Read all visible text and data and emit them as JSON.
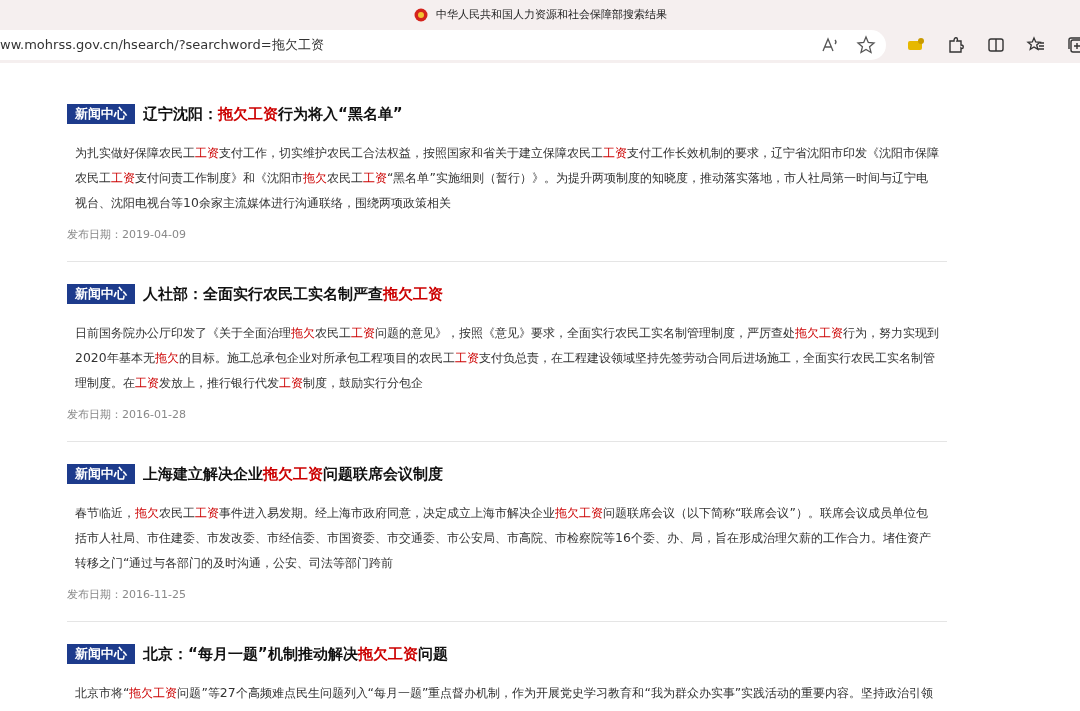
{
  "window": {
    "title": "中华人民共和国人力资源和社会保障部搜索结果"
  },
  "address_bar": {
    "url": "ww.mohrss.gov.cn/hsearch/?searchword=拖欠工资"
  },
  "results": [
    {
      "badge": "新闻中心",
      "title": [
        {
          "text": "辽宁沈阳：",
          "hit": false
        },
        {
          "text": "拖欠工资",
          "hit": true
        },
        {
          "text": "行为将入“黑名单”",
          "hit": false
        }
      ],
      "summary": [
        {
          "text": "为扎实做好保障农民工",
          "hit": false
        },
        {
          "text": "工资",
          "hit": true
        },
        {
          "text": "支付工作，切实维护农民工合法权益，按照国家和省关于建立保障农民工",
          "hit": false
        },
        {
          "text": "工资",
          "hit": true
        },
        {
          "text": "支付工作长效机制的要求，辽宁省沈阳市印发《沈阳市保障农民工",
          "hit": false
        },
        {
          "text": "工资",
          "hit": true
        },
        {
          "text": "支付问责工作制度》和《沈阳市",
          "hit": false
        },
        {
          "text": "拖欠",
          "hit": true
        },
        {
          "text": "农民工",
          "hit": false
        },
        {
          "text": "工资",
          "hit": true
        },
        {
          "text": "“黑名单”实施细则（暂行）》。为提升两项制度的知晓度，推动落实落地，市人社局第一时间与辽宁电视台、沈阳电视台等10余家主流媒体进行沟通联络，围绕两项政策相关",
          "hit": false
        }
      ],
      "date": "发布日期：2019-04-09"
    },
    {
      "badge": "新闻中心",
      "title": [
        {
          "text": "人社部：全面实行农民工实名制严查",
          "hit": false
        },
        {
          "text": "拖欠工资",
          "hit": true
        }
      ],
      "summary": [
        {
          "text": "日前国务院办公厅印发了《关于全面治理",
          "hit": false
        },
        {
          "text": "拖欠",
          "hit": true
        },
        {
          "text": "农民工",
          "hit": false
        },
        {
          "text": "工资",
          "hit": true
        },
        {
          "text": "问题的意见》，按照《意见》要求，全面实行农民工实名制管理制度，严厉查处",
          "hit": false
        },
        {
          "text": "拖欠工资",
          "hit": true
        },
        {
          "text": "行为，努力实现到2020年基本无",
          "hit": false
        },
        {
          "text": "拖欠",
          "hit": true
        },
        {
          "text": "的目标。施工总承包企业对所承包工程项目的农民工",
          "hit": false
        },
        {
          "text": "工资",
          "hit": true
        },
        {
          "text": "支付负总责，在工程建设领域坚持先签劳动合同后进场施工，全面实行农民工实名制管理制度。在",
          "hit": false
        },
        {
          "text": "工资",
          "hit": true
        },
        {
          "text": "发放上，推行银行代发",
          "hit": false
        },
        {
          "text": "工资",
          "hit": true
        },
        {
          "text": "制度，鼓励实行分包企",
          "hit": false
        }
      ],
      "date": "发布日期：2016-01-28"
    },
    {
      "badge": "新闻中心",
      "title": [
        {
          "text": "上海建立解决企业",
          "hit": false
        },
        {
          "text": "拖欠工资",
          "hit": true
        },
        {
          "text": "问题联席会议制度",
          "hit": false
        }
      ],
      "summary": [
        {
          "text": "春节临近，",
          "hit": false
        },
        {
          "text": "拖欠",
          "hit": true
        },
        {
          "text": "农民工",
          "hit": false
        },
        {
          "text": "工资",
          "hit": true
        },
        {
          "text": "事件进入易发期。经上海市政府同意，决定成立上海市解决企业",
          "hit": false
        },
        {
          "text": "拖欠工资",
          "hit": true
        },
        {
          "text": "问题联席会议（以下简称“联席会议”）。联席会议成员单位包括市人社局、市住建委、市发改委、市经信委、市国资委、市交通委、市公安局、市高院、市检察院等16个委、办、局，旨在形成治理欠薪的工作合力。堵住资产转移之门“通过与各部门的及时沟通，公安、司法等部门跨前",
          "hit": false
        }
      ],
      "date": "发布日期：2016-11-25"
    },
    {
      "badge": "新闻中心",
      "title": [
        {
          "text": "北京：“每月一题”机制推动解决",
          "hit": false
        },
        {
          "text": "拖欠工资",
          "hit": true
        },
        {
          "text": "问题",
          "hit": false
        }
      ],
      "summary": [
        {
          "text": "北京市将“",
          "hit": false
        },
        {
          "text": "拖欠工资",
          "hit": true
        },
        {
          "text": "问题”等27个高频难点民生问题列入“每月一题”重点督办机制，作为开展党史学习教育和“我为群众办实事”实践活动的重要内容。坚持政治引领",
          "hit": false
        }
      ]
    }
  ]
}
